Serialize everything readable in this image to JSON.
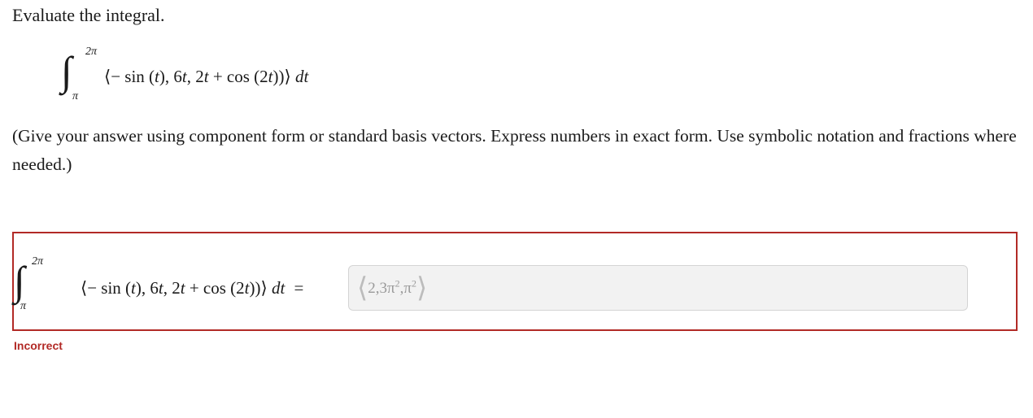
{
  "prompt": "Evaluate the integral.",
  "integral": {
    "upper_limit": "2π",
    "lower_limit": "π",
    "integrand_open": "⟨− sin (",
    "var": "t",
    "part2": "), 6",
    "part3": ", 2",
    "part4": " + cos (2",
    "part5": "))⟩ ",
    "dt": "dt"
  },
  "instructions": "(Give your answer using component form or standard basis vectors. Express numbers in exact form. Use symbolic notation and fractions where needed.)",
  "answer": {
    "equals": "=",
    "open": "⟨",
    "c1": "2,3π",
    "e1": "2",
    "c2": ",π",
    "e2": "2",
    "close": "⟩"
  },
  "status": "Incorrect",
  "colors": {
    "error": "#b22a26",
    "field_bg": "#f2f2f2"
  }
}
